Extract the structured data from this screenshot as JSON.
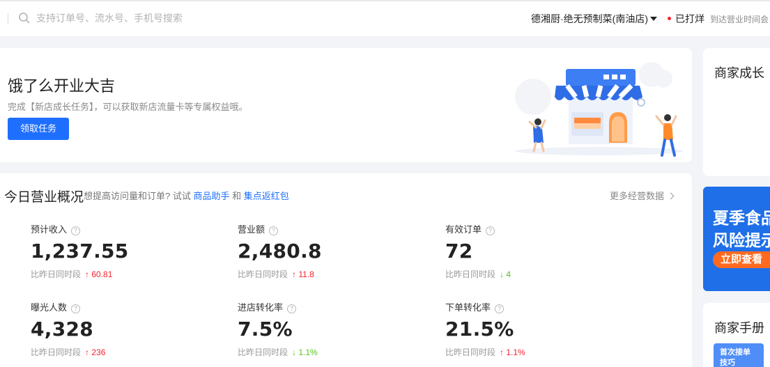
{
  "header": {
    "search_placeholder": "支持订单号、流水号、手机号搜索",
    "store_name": "德湘厨·绝无预制菜(南油店)",
    "status_label": "已打烊",
    "status_note": "到达营业时间会自"
  },
  "banner": {
    "title": "饿了么开业大吉",
    "description": "完成【新店成长任务】，可以获取新店流量卡等专属权益哦。",
    "button_label": "领取任务"
  },
  "overview": {
    "title": "今日营业概况",
    "hint_prefix": "想提高访问量和订单? 试试",
    "hint_link1": "商品助手",
    "hint_and": "和",
    "hint_link2": "集点返红包",
    "more_label": "更多经营数据",
    "compare_label": "比昨日同时段",
    "metrics": [
      {
        "label": "预计收入",
        "value": "1,237.55",
        "trend": "↑",
        "delta": "60.81"
      },
      {
        "label": "营业额",
        "value": "2,480.8",
        "trend": "↑",
        "delta": "11.8"
      },
      {
        "label": "有效订单",
        "value": "72",
        "trend": "↓",
        "delta": "4"
      },
      {
        "label": "曝光人数",
        "value": "4,328",
        "trend": "↑",
        "delta": "236"
      },
      {
        "label": "进店转化率",
        "value": "7.5%",
        "trend": "↓",
        "delta": "1.1%"
      },
      {
        "label": "下单转化率",
        "value": "21.5%",
        "trend": "↑",
        "delta": "1.1%"
      }
    ]
  },
  "sidebar": {
    "growth_title": "商家成长",
    "promo_line1": "夏季食品",
    "promo_line2": "风险提示",
    "promo_button": "立即查看",
    "manual_title": "商家手册",
    "manual_tile_line1": "首次接单",
    "manual_tile_line2": "技巧"
  },
  "colors": {
    "primary": "#1e6fff",
    "up": "#f5222d",
    "down": "#52c41a",
    "promo_bg": "#1f6fe8",
    "promo_button": "#ff6a1f"
  }
}
